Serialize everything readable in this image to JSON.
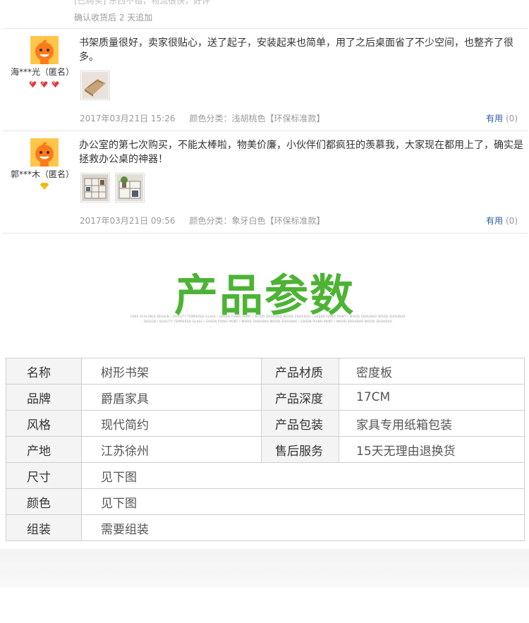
{
  "top": {
    "cut_text": "[已购买] 东西不错，物流很快，好评",
    "append_text": "确认收货后 2 天追加"
  },
  "reviews": [
    {
      "nick": "海***光（匿名）",
      "content": "书架质量很好，卖家很贴心，送了起子，安装起来也简单，用了之后桌面省了不少空间，也整齐了很多。",
      "date": "2017年03月21日 15:26",
      "spec": "颜色分类：浅胡桃色【环保标准款】",
      "useful_label": "有用",
      "useful_count": "(0)",
      "badge_icon": "red-heart-badge-icon",
      "badge_color": "#e4393c"
    },
    {
      "nick": "郭***木（匿名）",
      "content": "办公室的第七次购买，不能太棒啦，物美价廉，小伙伴们都疯狂的羡慕我，大家现在都用上了，确实是拯救办公桌的神器！",
      "date": "2017年03月21日 09:56",
      "spec": "颜色分类：象牙白色【环保标准款】",
      "useful_label": "有用",
      "useful_count": "(0)",
      "badge_icon": "yellow-diamond-badge-icon",
      "badge_color": "#f0c419"
    }
  ],
  "banner": {
    "title": "产品参数",
    "sub_line1": "FREE SCALABLE DESIGN / QUALITY TEMPERED GLASS / GREEN PIANO PAINT / WOOD ZHOUDAO WOOD ZHOUDAO / GREEN PIANO PAINT / WOOD ZHOUDAO WOOD ZHOUDAO",
    "sub_line2": "DESIGN / QUALITY TEMPERED GLASS / GREEN PIANO PAINT / WOOD ZHOUDAO WOOD ZHOUDAO / GREEN PIANO PAINT / WOOD ZHOUDAO WOOD ZHOUDAO",
    "accent_color": "#4db335"
  },
  "params": {
    "rows_pair": [
      {
        "k1": "名称",
        "v1": "树形书架",
        "k2": "产品材质",
        "v2": "密度板"
      },
      {
        "k1": "品牌",
        "v1": "爵盾家具",
        "k2": "产品深度",
        "v2": "17CM"
      },
      {
        "k1": "风格",
        "v1": "现代简约",
        "k2": "产品包装",
        "v2": "家具专用纸箱包装"
      },
      {
        "k1": "产地",
        "v1": "江苏徐州",
        "k2": "售后服务",
        "v2": "15天无理由退换货"
      }
    ],
    "rows_single": [
      {
        "k": "尺寸",
        "v": "见下图"
      },
      {
        "k": "颜色",
        "v": "见下图"
      },
      {
        "k": "组装",
        "v": "需要组装"
      }
    ]
  }
}
